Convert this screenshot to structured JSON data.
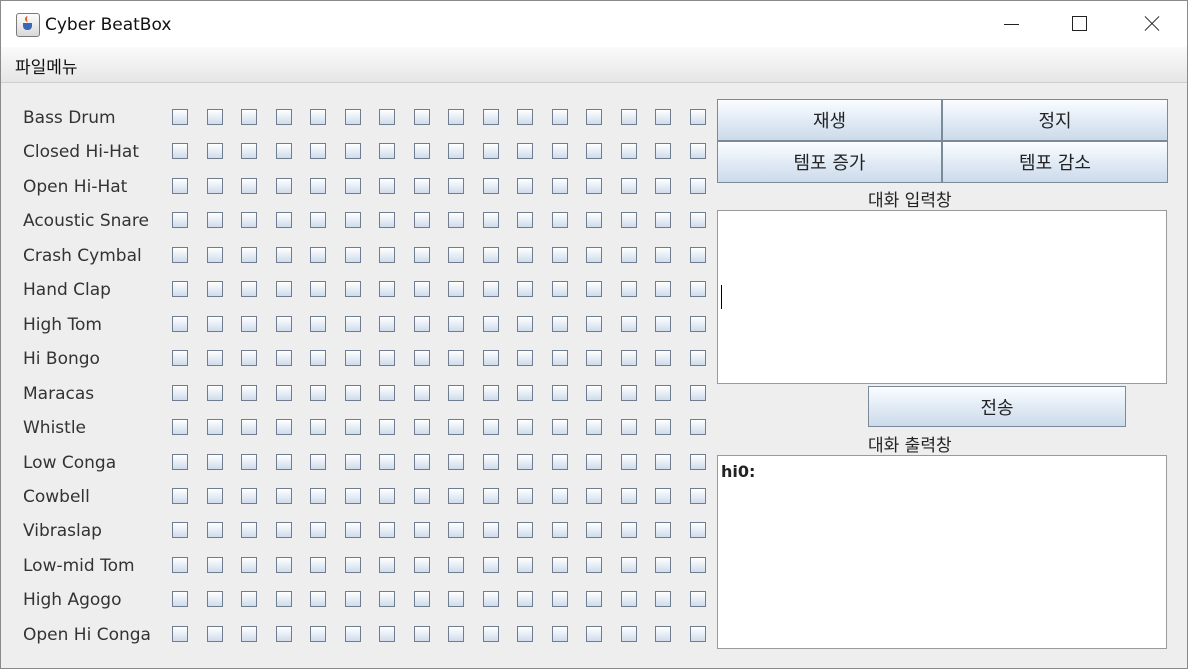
{
  "window": {
    "title": "Cyber BeatBox"
  },
  "menu": {
    "items": [
      "파일메뉴"
    ]
  },
  "instruments": [
    "Bass Drum",
    "Closed Hi-Hat",
    "Open Hi-Hat",
    "Acoustic Snare",
    "Crash Cymbal",
    "Hand Clap",
    "High Tom",
    "Hi Bongo",
    "Maracas",
    "Whistle",
    "Low Conga",
    "Cowbell",
    "Vibraslap",
    "Low-mid Tom",
    "High Agogo",
    "Open Hi Conga"
  ],
  "beats_per_instrument": 16,
  "controls": {
    "play": "재생",
    "stop": "정지",
    "tempo_up": "템포 증가",
    "tempo_down": "템포 감소"
  },
  "chat": {
    "input_label": "대화 입력창",
    "input_value": "",
    "send": "전송",
    "output_label": "대화 출력창",
    "output_text": "hi0:"
  }
}
